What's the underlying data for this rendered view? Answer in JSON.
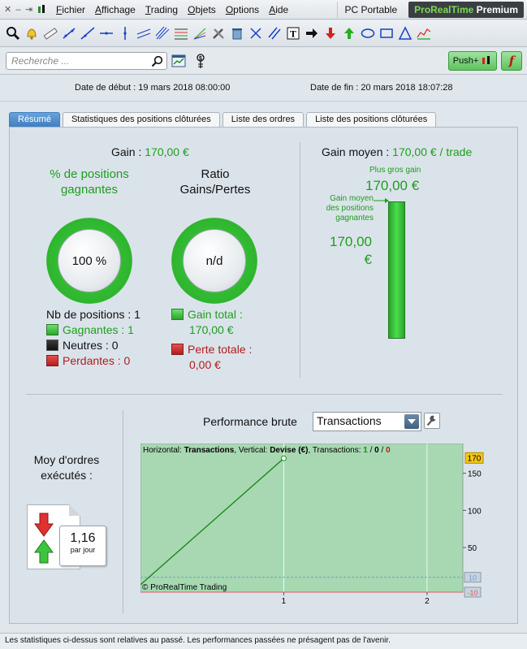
{
  "menubar": {
    "items": [
      "Fichier",
      "Affichage",
      "Trading",
      "Objets",
      "Options",
      "Aide"
    ],
    "device": "PC Portable",
    "brand_a": "ProRealTime",
    "brand_b": "Premium"
  },
  "search": {
    "placeholder": "Recherche ..."
  },
  "actions": {
    "push_label": "Push+",
    "f_label": "f"
  },
  "dates": {
    "start": "Date de début : 19 mars 2018 08:00:00",
    "end": "Date de fin : 20 mars 2018 18:07:28"
  },
  "tabs": [
    "Résumé",
    "Statistiques des positions clôturées",
    "Liste des ordres",
    "Liste des positions clôturées"
  ],
  "summary": {
    "gain_label": "Gain : ",
    "gain_value": "170,00 €",
    "pct_label": "% de positions gagnantes",
    "pct_value": "100 %",
    "pct_fraction": 1.0,
    "ratio_label": "Ratio Gains/Pertes",
    "ratio_value": "n/d",
    "nb_positions": "Nb de positions : 1",
    "gagnantes": "Gagnantes : 1",
    "neutres": "Neutres : 0",
    "perdantes": "Perdantes : 0",
    "gain_total_label": "Gain total :",
    "gain_total_value": "170,00 €",
    "perte_totale_label": "Perte totale :",
    "perte_totale_value": "0,00 €"
  },
  "gain_moyen": {
    "title_label": "Gain moyen : ",
    "title_value": "170,00 € / trade",
    "plus_gros_label": "Plus gros gain",
    "plus_gros_value": "170,00 €",
    "pos_label": "Gain moyen des positions gagnantes",
    "pos_value": "170,00 €"
  },
  "orders": {
    "title": "Moy d'ordres exécutés :",
    "value": "1,16",
    "unit": "par jour"
  },
  "performance": {
    "label": "Performance brute",
    "select_value": "Transactions"
  },
  "chart_data": {
    "type": "line",
    "header_prefix_h": "Horizontal: ",
    "header_h": "Transactions",
    "header_mid": ", Vertical: ",
    "header_v": "Devise (€)",
    "header_tx": ", Transactions: ",
    "tx_win": "1",
    "tx_sep": " / ",
    "tx_neutral": "0",
    "tx_lose": "0",
    "copyright": "© ProRealTime Trading",
    "x": [
      0,
      1
    ],
    "y": [
      0,
      170
    ],
    "xlim": [
      0,
      2.25
    ],
    "ylim": [
      -10,
      190
    ],
    "x_ticks": [
      "1",
      "2"
    ],
    "y_ticks": [
      "150",
      "100",
      "50"
    ],
    "last_value_label": "170",
    "ref_lines": [
      "10",
      "-10"
    ],
    "grid": true,
    "colors": {
      "area": "#a8d8b2",
      "line": "#1e8a1e",
      "plus_line": "#6a9fd0",
      "minus_line": "#e05a5a"
    }
  },
  "footer": {
    "text": "Les statistiques ci-dessus sont relatives au passé. Les performances passées ne présagent pas de l'avenir."
  }
}
